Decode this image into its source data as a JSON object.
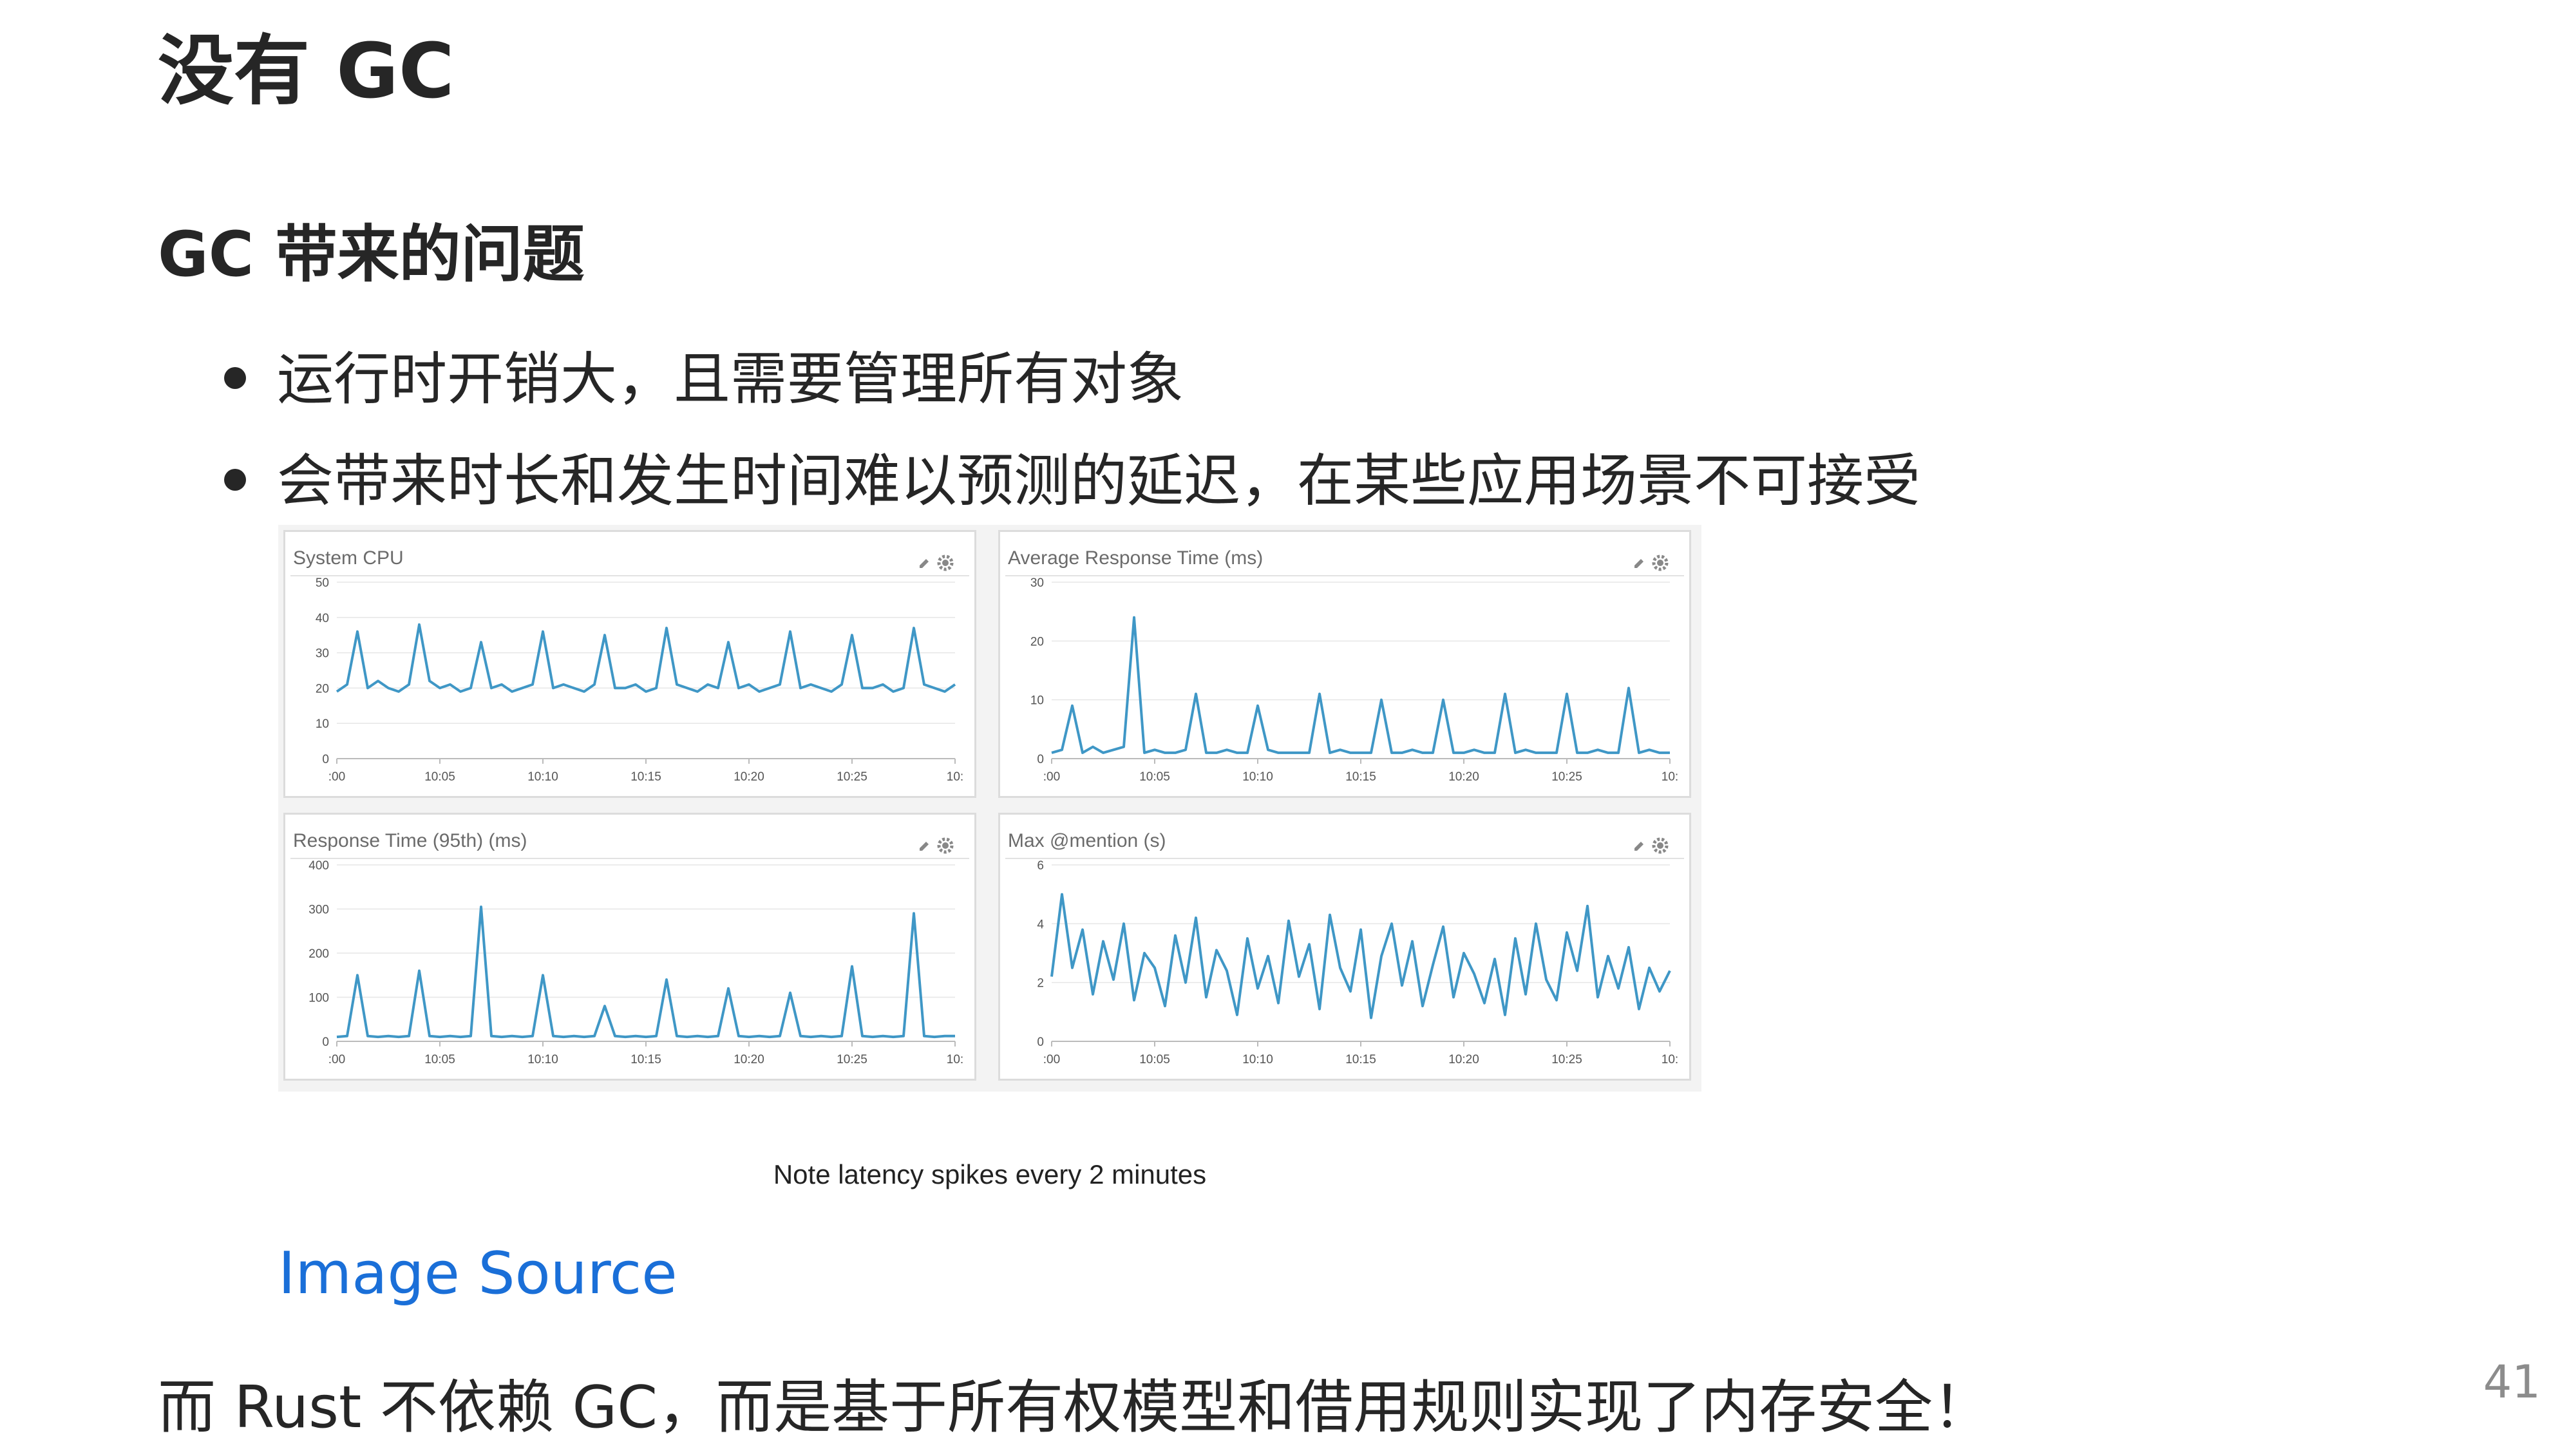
{
  "slide": {
    "title": "没有 GC",
    "subtitle": "GC 带来的问题",
    "bullets": [
      "运行时开销大，且需要管理所有对象",
      "会带来时长和发生时间难以预测的延迟，在某些应用场景不可接受"
    ],
    "figure_caption": "Note latency spikes every 2 minutes",
    "link_text": "Image Source",
    "footer": "而 Rust 不依赖 GC，而是基于所有权模型和借用规则实现了内存安全！",
    "page_number": "41"
  },
  "chart_style": {
    "line_color": "#3f97c6",
    "grid_color": "#e6e6e6",
    "panel_border": "#dcdcdc"
  },
  "chart_data": [
    {
      "type": "line",
      "title": "System CPU",
      "ylim": [
        0,
        50
      ],
      "yticks": [
        "0",
        "10",
        "20",
        "30",
        "40",
        "50"
      ],
      "xticks": [
        ":00",
        "10:05",
        "10:10",
        "10:15",
        "10:20",
        "10:25",
        "10:"
      ],
      "x_range": [
        0,
        30
      ],
      "series": [
        {
          "x": [
            0,
            0.5,
            1,
            1.5,
            2,
            2.5,
            3,
            3.5,
            4,
            4.5,
            5,
            5.5,
            6,
            6.5,
            7,
            7.5,
            8,
            8.5,
            9,
            9.5,
            10,
            10.5,
            11,
            11.5,
            12,
            12.5,
            13,
            13.5,
            14,
            14.5,
            15,
            15.5,
            16,
            16.5,
            17,
            17.5,
            18,
            18.5,
            19,
            19.5,
            20,
            20.5,
            21,
            21.5,
            22,
            22.5,
            23,
            23.5,
            24,
            24.5,
            25,
            25.5,
            26,
            26.5,
            27,
            27.5,
            28,
            28.5,
            29,
            29.5,
            30
          ],
          "y": [
            19,
            21,
            36,
            20,
            22,
            20,
            19,
            21,
            38,
            22,
            20,
            21,
            19,
            20,
            33,
            20,
            21,
            19,
            20,
            21,
            36,
            20,
            21,
            20,
            19,
            21,
            35,
            20,
            20,
            21,
            19,
            20,
            37,
            21,
            20,
            19,
            21,
            20,
            33,
            20,
            21,
            19,
            20,
            21,
            36,
            20,
            21,
            20,
            19,
            21,
            35,
            20,
            20,
            21,
            19,
            20,
            37,
            21,
            20,
            19,
            21
          ]
        }
      ]
    },
    {
      "type": "line",
      "title": "Average Response Time (ms)",
      "ylim": [
        0,
        30
      ],
      "yticks": [
        "0",
        "10",
        "20",
        "30"
      ],
      "xticks": [
        ":00",
        "10:05",
        "10:10",
        "10:15",
        "10:20",
        "10:25",
        "10:"
      ],
      "x_range": [
        0,
        30
      ],
      "series": [
        {
          "x": [
            0,
            0.5,
            1,
            1.5,
            2,
            2.5,
            3,
            3.5,
            4,
            4.5,
            5,
            5.5,
            6,
            6.5,
            7,
            7.5,
            8,
            8.5,
            9,
            9.5,
            10,
            10.5,
            11,
            11.5,
            12,
            12.5,
            13,
            13.5,
            14,
            14.5,
            15,
            15.5,
            16,
            16.5,
            17,
            17.5,
            18,
            18.5,
            19,
            19.5,
            20,
            20.5,
            21,
            21.5,
            22,
            22.5,
            23,
            23.5,
            24,
            24.5,
            25,
            25.5,
            26,
            26.5,
            27,
            27.5,
            28,
            28.5,
            29,
            29.5,
            30
          ],
          "y": [
            1,
            1.5,
            9,
            1,
            2,
            1,
            1.5,
            2,
            24,
            1,
            1.5,
            1,
            1,
            1.5,
            11,
            1,
            1,
            1.5,
            1,
            1,
            9,
            1.5,
            1,
            1,
            1,
            1,
            11,
            1,
            1.5,
            1,
            1,
            1,
            10,
            1,
            1,
            1.5,
            1,
            1,
            10,
            1,
            1,
            1.5,
            1,
            1,
            11,
            1,
            1.5,
            1,
            1,
            1,
            11,
            1,
            1,
            1.5,
            1,
            1,
            12,
            1,
            1.5,
            1,
            1
          ]
        }
      ]
    },
    {
      "type": "line",
      "title": "Response Time (95th) (ms)",
      "ylim": [
        0,
        400
      ],
      "yticks": [
        "0",
        "100",
        "200",
        "300",
        "400"
      ],
      "xticks": [
        ":00",
        "10:05",
        "10:10",
        "10:15",
        "10:20",
        "10:25",
        "10:"
      ],
      "x_range": [
        0,
        30
      ],
      "series": [
        {
          "x": [
            0,
            0.5,
            1,
            1.5,
            2,
            2.5,
            3,
            3.5,
            4,
            4.5,
            5,
            5.5,
            6,
            6.5,
            7,
            7.5,
            8,
            8.5,
            9,
            9.5,
            10,
            10.5,
            11,
            11.5,
            12,
            12.5,
            13,
            13.5,
            14,
            14.5,
            15,
            15.5,
            16,
            16.5,
            17,
            17.5,
            18,
            18.5,
            19,
            19.5,
            20,
            20.5,
            21,
            21.5,
            22,
            22.5,
            23,
            23.5,
            24,
            24.5,
            25,
            25.5,
            26,
            26.5,
            27,
            27.5,
            28,
            28.5,
            29,
            29.5,
            30
          ],
          "y": [
            10,
            12,
            150,
            12,
            10,
            12,
            10,
            12,
            160,
            12,
            10,
            12,
            10,
            12,
            305,
            12,
            10,
            12,
            10,
            12,
            150,
            12,
            10,
            12,
            10,
            12,
            80,
            12,
            10,
            12,
            10,
            12,
            140,
            12,
            10,
            12,
            10,
            12,
            120,
            12,
            10,
            12,
            10,
            12,
            110,
            12,
            10,
            12,
            10,
            12,
            170,
            12,
            10,
            12,
            10,
            12,
            290,
            12,
            10,
            12,
            12
          ]
        }
      ]
    },
    {
      "type": "line",
      "title": "Max @mention (s)",
      "ylim": [
        0,
        6
      ],
      "yticks": [
        "0",
        "2",
        "4",
        "6"
      ],
      "xticks": [
        ":00",
        "10:05",
        "10:10",
        "10:15",
        "10:20",
        "10:25",
        "10:"
      ],
      "x_range": [
        0,
        30
      ],
      "series": [
        {
          "x": [
            0,
            0.5,
            1,
            1.5,
            2,
            2.5,
            3,
            3.5,
            4,
            4.5,
            5,
            5.5,
            6,
            6.5,
            7,
            7.5,
            8,
            8.5,
            9,
            9.5,
            10,
            10.5,
            11,
            11.5,
            12,
            12.5,
            13,
            13.5,
            14,
            14.5,
            15,
            15.5,
            16,
            16.5,
            17,
            17.5,
            18,
            18.5,
            19,
            19.5,
            20,
            20.5,
            21,
            21.5,
            22,
            22.5,
            23,
            23.5,
            24,
            24.5,
            25,
            25.5,
            26,
            26.5,
            27,
            27.5,
            28,
            28.5,
            29,
            29.5,
            30
          ],
          "y": [
            2.2,
            5,
            2.5,
            3.8,
            1.6,
            3.4,
            2.1,
            4,
            1.4,
            3,
            2.5,
            1.2,
            3.6,
            2,
            4.2,
            1.5,
            3.1,
            2.4,
            0.9,
            3.5,
            1.8,
            2.9,
            1.3,
            4.1,
            2.2,
            3.3,
            1.1,
            4.3,
            2.5,
            1.7,
            3.8,
            0.8,
            2.9,
            4,
            1.9,
            3.4,
            1.2,
            2.6,
            3.9,
            1.5,
            3,
            2.3,
            1.3,
            2.8,
            0.9,
            3.5,
            1.6,
            4,
            2.1,
            1.4,
            3.7,
            2.4,
            4.6,
            1.5,
            2.9,
            1.8,
            3.2,
            1.1,
            2.5,
            1.7,
            2.4
          ]
        }
      ]
    }
  ]
}
